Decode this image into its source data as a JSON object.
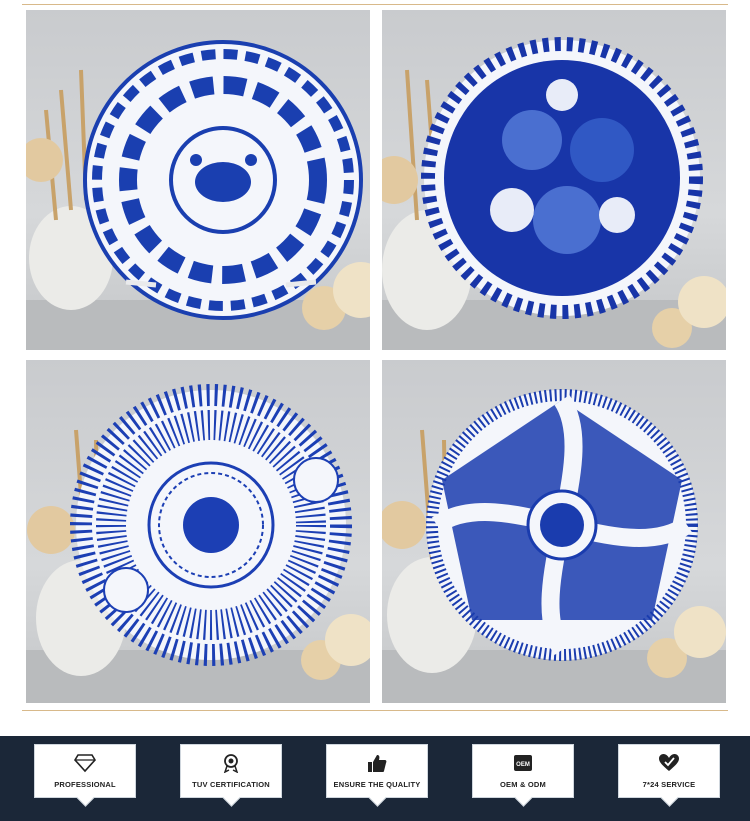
{
  "badges": [
    {
      "label": "PROFESSIONAL",
      "icon": "diamond-icon"
    },
    {
      "label": "TUV CERTIFICATION",
      "icon": "award-medal-icon"
    },
    {
      "label": "ENSURE THE QUALITY",
      "icon": "thumbs-up-icon"
    },
    {
      "label": "OEM & ODM",
      "icon": "oem-box-icon"
    },
    {
      "label": "7*24 SERVICE",
      "icon": "heart-icon"
    }
  ],
  "plates": [
    {
      "pattern": "floral-phoenix",
      "color": "#1a3fb0"
    },
    {
      "pattern": "lotus-leaves",
      "color": "#1835a8"
    },
    {
      "pattern": "lattice-landscape",
      "color": "#1c3fb4"
    },
    {
      "pattern": "hexagon-landscape",
      "color": "#1a3cae"
    }
  ],
  "colors": {
    "footer_bg": "#1b2738",
    "accent_gold": "#d8b98a",
    "cobalt": "#1a3fb0"
  }
}
